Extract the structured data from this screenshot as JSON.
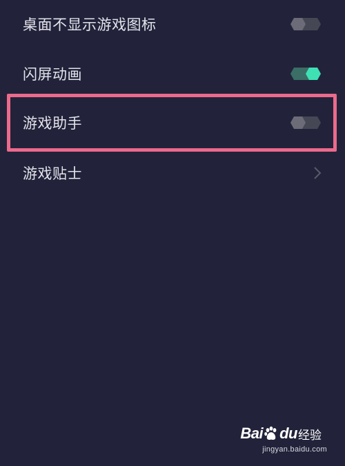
{
  "settings": {
    "items": [
      {
        "label": "桌面不显示游戏图标",
        "control": "toggle",
        "state": "off"
      },
      {
        "label": "闪屏动画",
        "control": "toggle",
        "state": "on"
      },
      {
        "label": "游戏助手",
        "control": "toggle",
        "state": "off",
        "highlighted": true
      },
      {
        "label": "游戏贴士",
        "control": "chevron"
      }
    ]
  },
  "colors": {
    "background": "#22233a",
    "text": "#e4e4ec",
    "toggle_on_thumb": "#3fe0b4",
    "toggle_on_track": "#3a6e66",
    "toggle_off_thumb": "#6b6c78",
    "toggle_off_track": "#464755",
    "highlight_border": "#ec6a8c"
  },
  "watermark": {
    "brand_left": "Bai",
    "brand_right": "du",
    "brand_suffix": "经验",
    "url": "jingyan.baidu.com"
  }
}
